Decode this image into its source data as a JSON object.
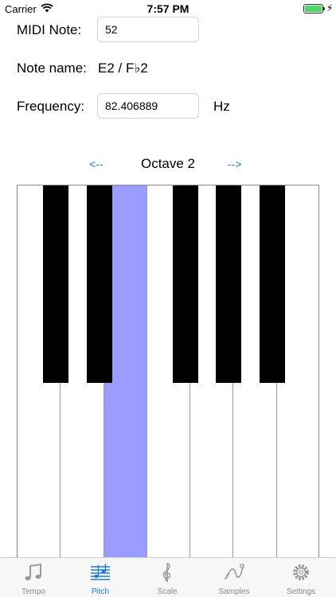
{
  "status": {
    "carrier": "Carrier",
    "time": "7:57 PM"
  },
  "form": {
    "midi_label": "MIDI Note:",
    "midi_value": "52",
    "name_label": "Note name:",
    "name_value": "E2  /  F♭2",
    "freq_label": "Frequency:",
    "freq_value": "82.406889",
    "freq_unit": "Hz"
  },
  "octave": {
    "prev": "<--",
    "label": "Octave 2",
    "next": "-->"
  },
  "keyboard": {
    "white_keys": 7,
    "active_white_key": 2,
    "black_after_white": [
      0,
      1,
      3,
      4,
      5
    ],
    "active_color": "#9a9dff"
  },
  "tabs": [
    {
      "label": "Tempo",
      "icon": "music-note-icon"
    },
    {
      "label": "Pitch",
      "icon": "staff-icon",
      "active": true
    },
    {
      "label": "Scale",
      "icon": "treble-clef-icon"
    },
    {
      "label": "Samples",
      "icon": "waveform-icon"
    },
    {
      "label": "Settings",
      "icon": "gear-icon"
    }
  ],
  "colors": {
    "accent": "#1a7ad9",
    "inactive": "#888888",
    "battery": "#4cd964"
  }
}
